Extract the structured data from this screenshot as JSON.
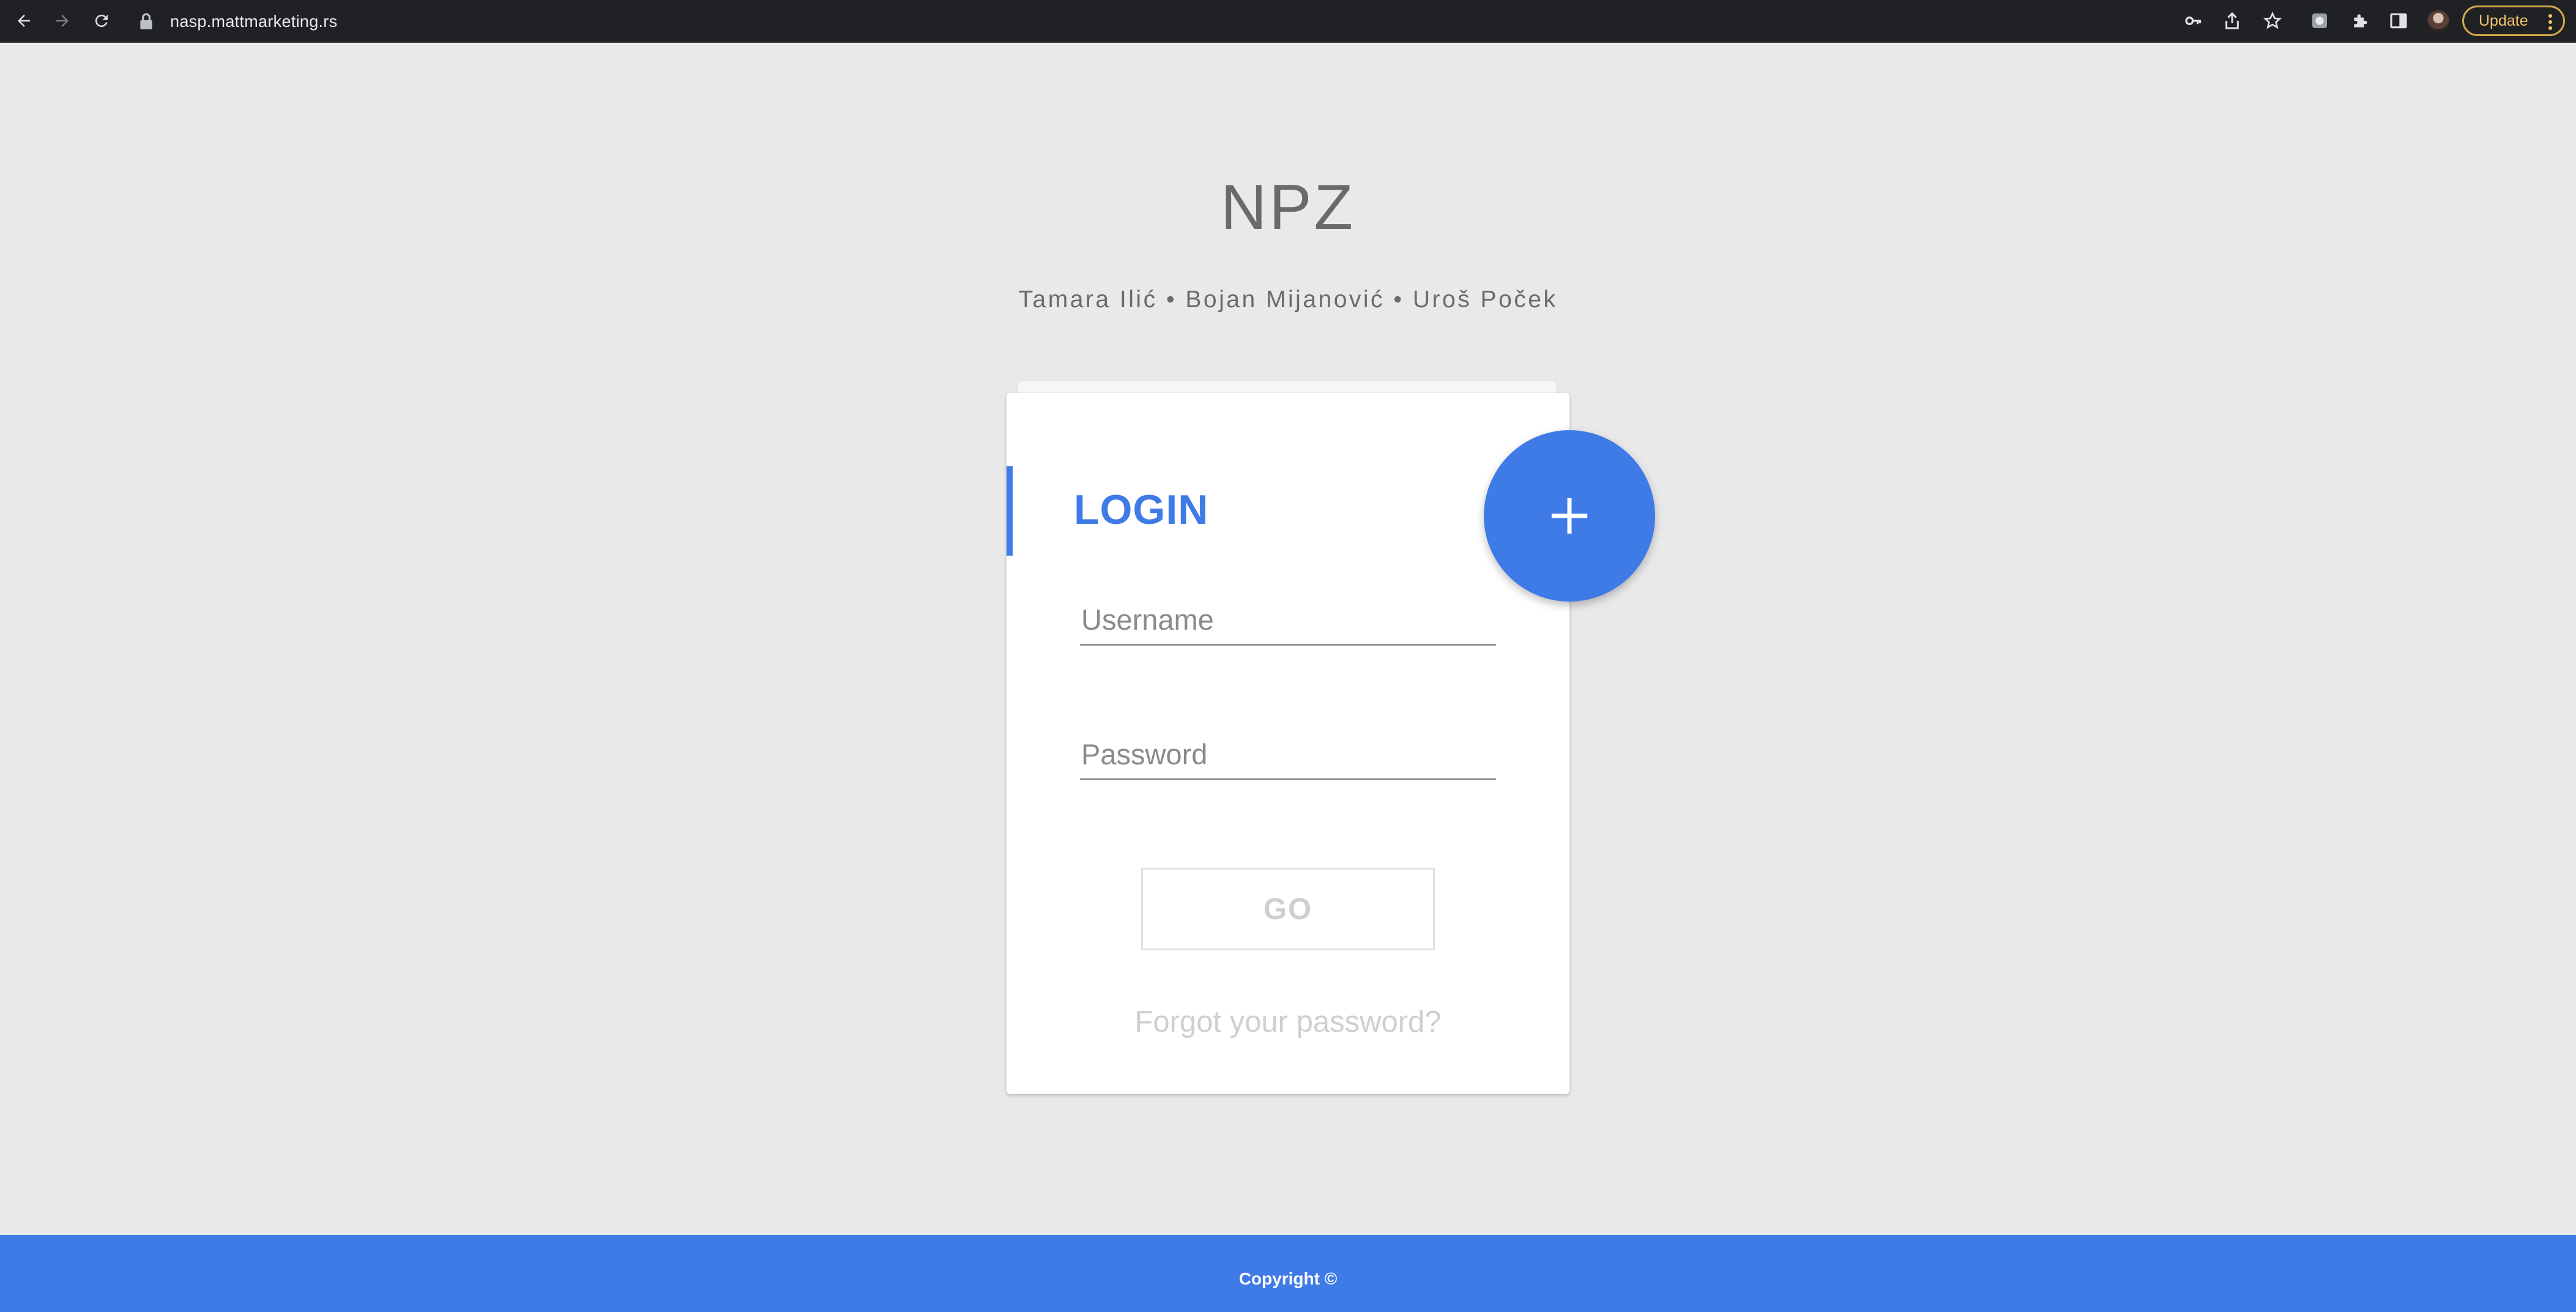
{
  "browser": {
    "url": "nasp.mattmarketing.rs",
    "update_label": "Update",
    "icons": [
      "back-arrow-icon",
      "forward-arrow-icon",
      "reload-icon",
      "lock-icon",
      "key-icon",
      "share-icon",
      "star-icon",
      "extension-square-icon",
      "puzzle-icon",
      "side-panel-icon",
      "avatar",
      "more-vert-icon"
    ]
  },
  "page": {
    "title": "NPZ",
    "authors": "Tamara Ilić • Bojan Mijanović • Uroš Poček"
  },
  "login": {
    "title": "LOGIN",
    "username_placeholder": "Username",
    "password_placeholder": "Password",
    "go_label": "GO",
    "forgot_label": "Forgot your password?",
    "fab_icon": "plus-icon"
  },
  "footer": {
    "copyright": "Copyright ©"
  },
  "colors": {
    "accent": "#3f7be6",
    "background": "#e9e9e9",
    "chrome": "#202124",
    "update_border": "#d4a94a"
  }
}
